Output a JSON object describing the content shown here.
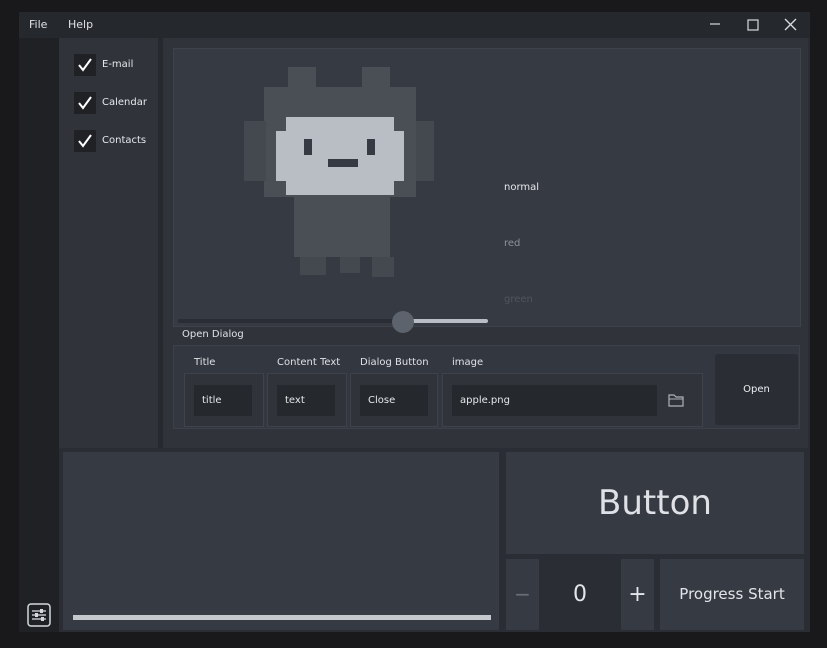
{
  "menu": {
    "file": "File",
    "help": "Help"
  },
  "window_controls": {
    "minimize_icon": "minimize-icon",
    "maximize_icon": "maximize-icon",
    "close_icon": "close-icon"
  },
  "sidebar": {
    "items": [
      {
        "label": "E-mail",
        "checked": true
      },
      {
        "label": "Calendar",
        "checked": true
      },
      {
        "label": "Contacts",
        "checked": true
      }
    ]
  },
  "preview": {
    "modes": [
      "normal",
      "red",
      "green"
    ],
    "slider_value": 0.67
  },
  "dialog": {
    "group_title": "Open Dialog",
    "title_label": "Title",
    "title_value": "title",
    "content_label": "Content Text",
    "content_value": "text",
    "button_label": "Dialog Button",
    "button_value": "Close",
    "image_label": "image",
    "image_value": "apple.png",
    "open_label": "Open"
  },
  "bottom": {
    "progress_value": 1.0,
    "big_button_label": "Button",
    "stepper_minus": "−",
    "stepper_value": "0",
    "stepper_plus": "+",
    "progress_start_label": "Progress Start"
  },
  "colors": {
    "background": "#2a2d33",
    "panel": "#363a42",
    "text": "#e6e8eb"
  }
}
